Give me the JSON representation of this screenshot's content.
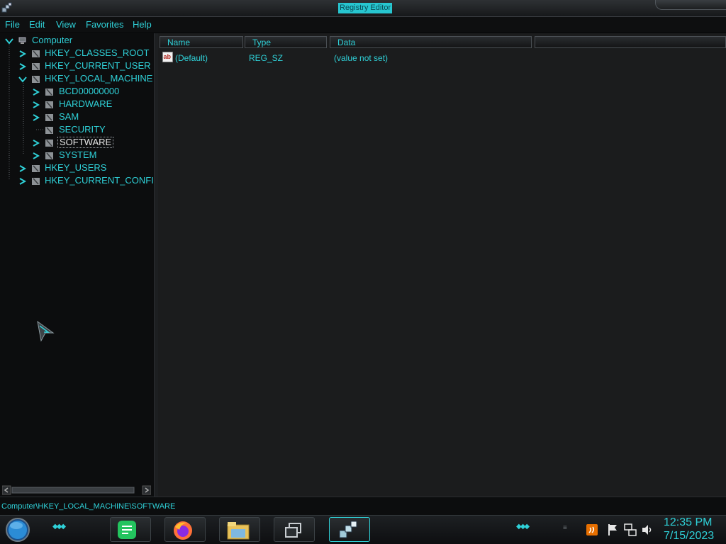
{
  "window": {
    "title": "Registry Editor"
  },
  "menu": [
    "File",
    "Edit",
    "View",
    "Favorites",
    "Help"
  ],
  "tree": {
    "root": "Computer",
    "hives": [
      "HKEY_CLASSES_ROOT",
      "HKEY_CURRENT_USER",
      "HKEY_LOCAL_MACHINE"
    ],
    "hklm_children": [
      "BCD00000000",
      "HARDWARE",
      "SAM",
      "SECURITY",
      "SOFTWARE",
      "SYSTEM"
    ],
    "more_hives": [
      "HKEY_USERS",
      "HKEY_CURRENT_CONFI"
    ],
    "selected": "SOFTWARE"
  },
  "list": {
    "columns": [
      "Name",
      "Type",
      "Data"
    ],
    "rows": [
      {
        "name": "(Default)",
        "type": "REG_SZ",
        "data": "(value not set)",
        "icon": "string-value-icon"
      }
    ]
  },
  "status": {
    "path": "Computer\\HKEY_LOCAL_MACHINE\\SOFTWARE"
  },
  "taskbar": {
    "apps": [
      "notes-app-icon",
      "firefox-icon",
      "file-explorer-icon",
      "task-view-icon",
      "registry-editor-icon"
    ],
    "tray": [
      "java-update-icon",
      "action-center-flag-icon",
      "network-icon",
      "volume-icon"
    ],
    "time": "12:35 PM",
    "date": "7/15/2023"
  },
  "colors": {
    "accent": "#2fd1d8",
    "pane_bg": "#1b1c1d",
    "tree_bg": "#0c0d0e"
  }
}
